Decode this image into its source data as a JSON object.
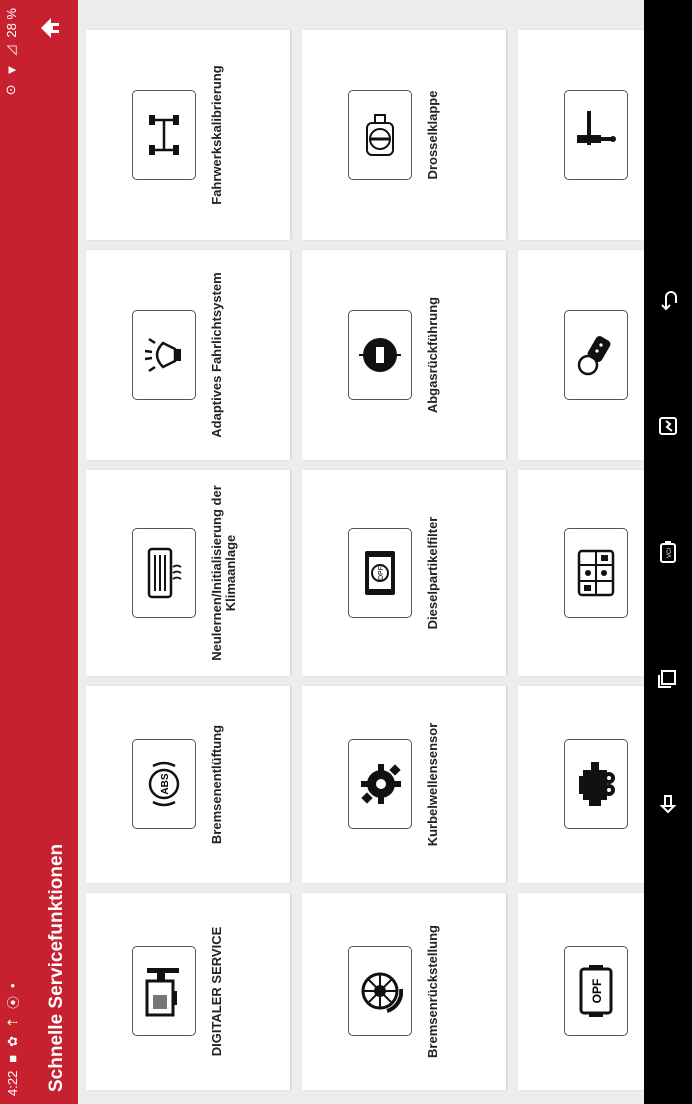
{
  "status_bar": {
    "time": "4:22",
    "battery": "28 %",
    "left_icons": [
      "message-icon",
      "settings-icon",
      "upload-icon",
      "bluetooth-icon",
      "dot-icon"
    ],
    "right_icons": [
      "location-icon",
      "wifi-icon",
      "signal-icon"
    ]
  },
  "header": {
    "title": "Schnelle Servicefunktionen",
    "home_icon": "home-icon",
    "color": "#c7202e"
  },
  "tiles": [
    {
      "label": "DIGITALER SERVICE",
      "icon": "digital-service-icon"
    },
    {
      "label": "Bremsenentlüftung",
      "icon": "abs-icon"
    },
    {
      "label": "Neulernen/Initialisierung der Klimaanlage",
      "icon": "air-conditioning-icon"
    },
    {
      "label": "Adaptives Fahrlichtsystem",
      "icon": "adaptive-light-icon"
    },
    {
      "label": "Fahrwerkskalibrierung",
      "icon": "chassis-icon"
    },
    {
      "label": "Bremsenrückstellung",
      "icon": "brake-disc-icon"
    },
    {
      "label": "Kurbelwellensensor",
      "icon": "crankshaft-gear-icon"
    },
    {
      "label": "Dieselpartikelfilter",
      "icon": "dpf-icon"
    },
    {
      "label": "Abgasrückführung",
      "icon": "egr-icon"
    },
    {
      "label": "Drosselklappe",
      "icon": "throttle-icon"
    },
    {
      "label": "",
      "icon": "opf-icon"
    },
    {
      "label": "",
      "icon": "engine-icon"
    },
    {
      "label": "",
      "icon": "battery-cells-icon"
    },
    {
      "label": "",
      "icon": "key-immobilizer-icon"
    },
    {
      "label": "",
      "icon": "injector-icon"
    }
  ],
  "nav_bar": {
    "icons": [
      "screenshot-back-icon",
      "recent-apps-icon",
      "vci-icon",
      "gallery-icon",
      "back-icon"
    ]
  }
}
